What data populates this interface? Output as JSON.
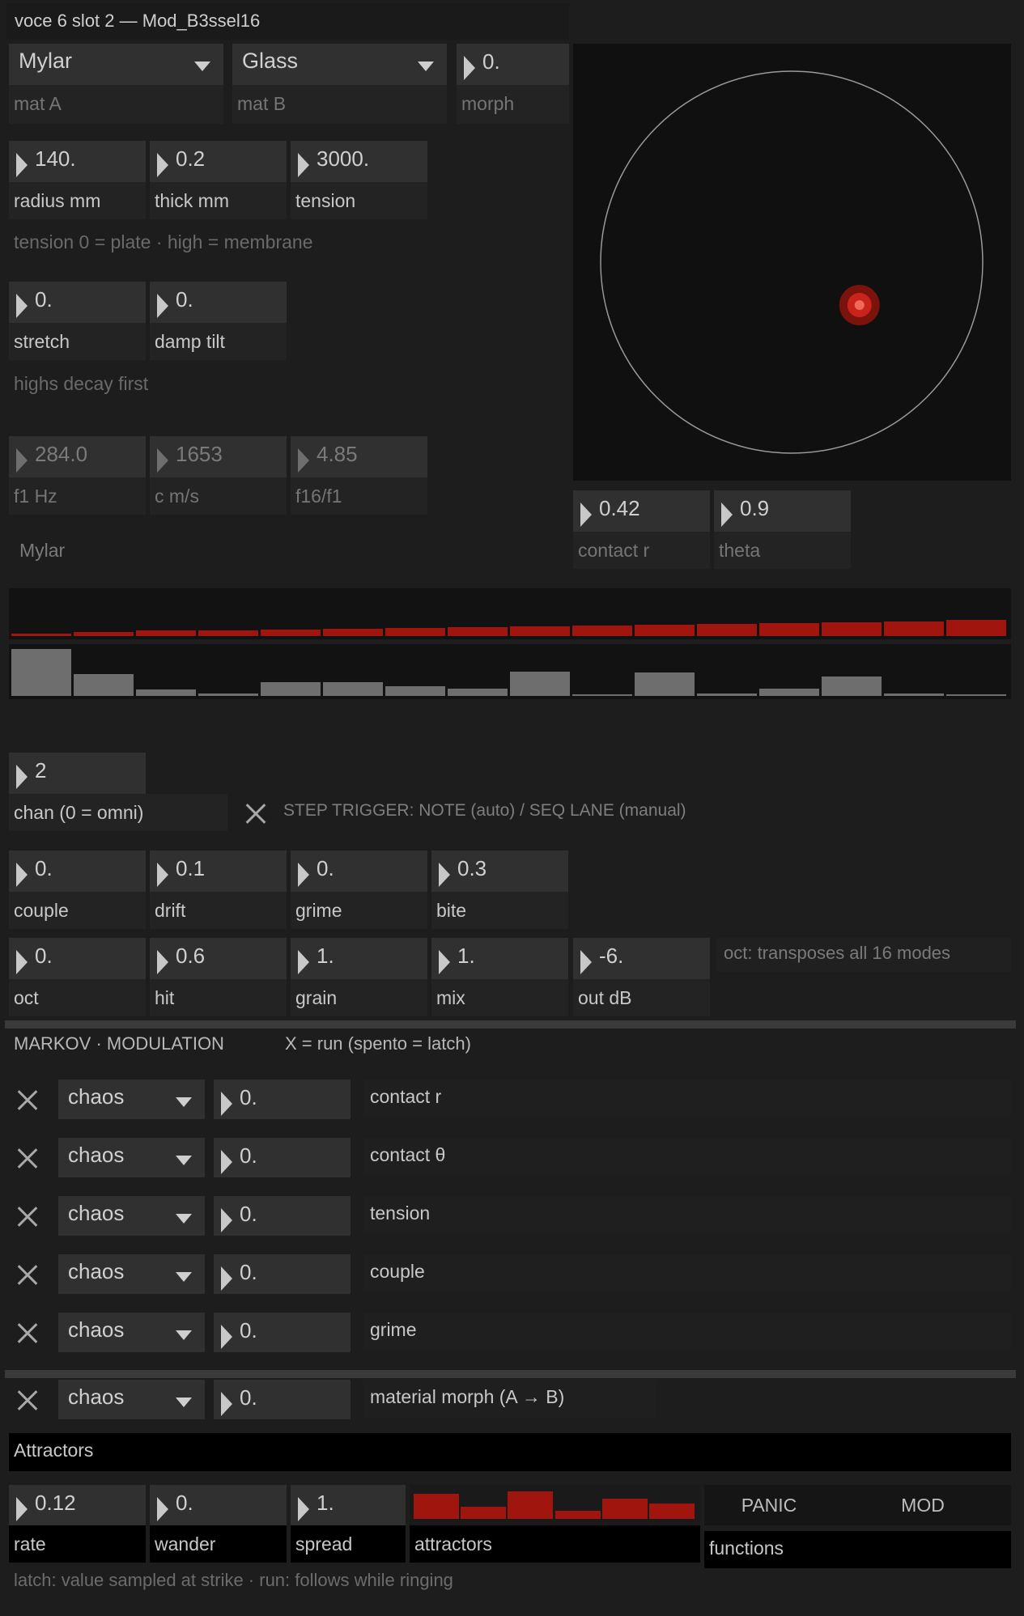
{
  "window": {
    "title": "voce 6 slot 2 — Mod_B3ssel16"
  },
  "materials": {
    "mat_a": {
      "value": "Mylar",
      "label": "mat A"
    },
    "mat_b": {
      "value": "Glass",
      "label": "mat B"
    },
    "morph": {
      "value": "0.",
      "label": "morph"
    }
  },
  "geometry": {
    "radius": {
      "value": "140.",
      "label": "radius mm"
    },
    "thick": {
      "value": "0.2",
      "label": "thick mm"
    },
    "tension": {
      "value": "3000.",
      "label": "tension"
    },
    "hint": "tension 0 = plate · high = membrane"
  },
  "damping": {
    "stretch": {
      "value": "0.",
      "label": "stretch"
    },
    "damp_tilt": {
      "value": "0.",
      "label": "damp tilt"
    },
    "hint": "highs decay first"
  },
  "readouts": {
    "f1": {
      "value": "284.0",
      "label": "f1 Hz"
    },
    "c": {
      "value": "1653",
      "label": "c m/s"
    },
    "ratio": {
      "value": "4.85",
      "label": "f16/f1"
    },
    "material_name": "Mylar"
  },
  "pad": {
    "contact_r": {
      "value": "0.42",
      "label": "contact r"
    },
    "theta": {
      "value": "0.9",
      "label": "theta"
    },
    "point_r": 0.42,
    "point_theta": 0.9,
    "ring_color": "#9a9a9a",
    "dot_color": "#c8241a"
  },
  "modes": {
    "top_bars": [
      0.12,
      0.18,
      0.24,
      0.26,
      0.3,
      0.32,
      0.36,
      0.38,
      0.42,
      0.46,
      0.5,
      0.54,
      0.58,
      0.62,
      0.66,
      0.7
    ],
    "bottom_bars": [
      1.0,
      0.47,
      0.14,
      0.05,
      0.3,
      0.3,
      0.2,
      0.15,
      0.52,
      0.04,
      0.5,
      0.05,
      0.15,
      0.42,
      0.06,
      0.04
    ],
    "top_color": "#a0160e",
    "bottom_color": "#6e6e6e"
  },
  "midi": {
    "chan": {
      "value": "2",
      "label": "chan  (0 = omni)"
    },
    "step_trigger_label": "STEP TRIGGER: NOTE (auto) / SEQ LANE (manual)"
  },
  "tone": {
    "couple": {
      "value": "0.",
      "label": "couple"
    },
    "drift": {
      "value": "0.1",
      "label": "drift"
    },
    "grime": {
      "value": "0.",
      "label": "grime"
    },
    "bite": {
      "value": "0.3",
      "label": "bite"
    }
  },
  "output": {
    "oct": {
      "value": "0.",
      "label": "oct"
    },
    "hit": {
      "value": "0.6",
      "label": "hit"
    },
    "grain": {
      "value": "1.",
      "label": "grain"
    },
    "mix": {
      "value": "1.",
      "label": "mix"
    },
    "out_db": {
      "value": "-6.",
      "label": "out dB"
    },
    "hint": "oct: transposes all 16 modes"
  },
  "markov": {
    "title": "MARKOV · MODULATION",
    "subtitle": "X = run  (spento = latch)",
    "rows": [
      {
        "mode": "chaos",
        "amount": "0.",
        "target": "contact r"
      },
      {
        "mode": "chaos",
        "amount": "0.",
        "target": "contact θ"
      },
      {
        "mode": "chaos",
        "amount": "0.",
        "target": "tension"
      },
      {
        "mode": "chaos",
        "amount": "0.",
        "target": "couple"
      },
      {
        "mode": "chaos",
        "amount": "0.",
        "target": "grime"
      }
    ],
    "morph_row": {
      "mode": "chaos",
      "amount": "0.",
      "target": "material morph  (A → B)"
    }
  },
  "attractors": {
    "title": "Attractors",
    "rate": {
      "value": "0.12",
      "label": "rate"
    },
    "wander": {
      "value": "0.",
      "label": "wander"
    },
    "spread": {
      "value": "1.",
      "label": "spread"
    },
    "label": "attractors",
    "bars": [
      0.9,
      0.45,
      1.0,
      0.3,
      0.75,
      0.55
    ],
    "bar_color": "#a0160e",
    "panic": "PANIC",
    "mod": "MOD",
    "functions": "functions",
    "footer": "latch: value sampled at strike · run: follows while ringing"
  }
}
